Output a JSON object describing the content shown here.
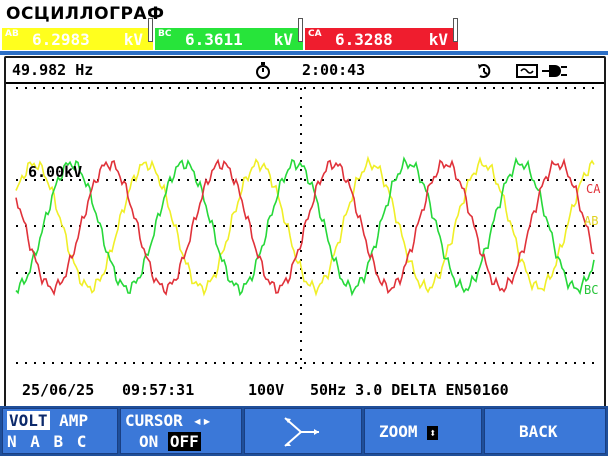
{
  "header": {
    "title": "ОСЦИЛЛОГРАФ"
  },
  "readings": [
    {
      "phase": "AB",
      "value": "6.2983",
      "unit": "kV",
      "color": "#ffff1e"
    },
    {
      "phase": "BC",
      "value": "6.3611",
      "unit": "kV",
      "color": "#27e43a"
    },
    {
      "phase": "CA",
      "value": "6.3288",
      "unit": "kV",
      "color": "#ef1d2e"
    }
  ],
  "status": {
    "frequency": "49.982 Hz",
    "time": "2:00:43",
    "timer_icon": "stopwatch-icon",
    "trend_icon": "trend-icon",
    "power_icon": "mains-plug-icon"
  },
  "scope": {
    "scale_label": "6.00kV",
    "channel_labels": [
      "CA",
      "AB",
      "BC"
    ],
    "grid": true
  },
  "footer": {
    "date": "25/06/25",
    "clock": "09:57:31",
    "nominal": "100V",
    "config": "50Hz 3.0 DELTA EN50160"
  },
  "function_keys": {
    "volt_label": "VOLT",
    "amp_label": "AMP",
    "phases_row": "N A B C",
    "cursor_label": "CURSOR",
    "cursor_on": "ON",
    "cursor_off": "OFF",
    "zoom_label": "ZOOM",
    "back_label": "BACK"
  },
  "chart_data": {
    "type": "line",
    "xlabel": "",
    "ylabel": "",
    "ylim": [
      -9,
      9
    ],
    "series": [
      {
        "name": "AB",
        "amplitude_kV": 6.2983,
        "color": "#f0ef28"
      },
      {
        "name": "BC",
        "amplitude_kV": 6.3611,
        "color": "#27d83a"
      },
      {
        "name": "CA",
        "amplitude_kV": 6.3288,
        "color": "#e0323a"
      }
    ]
  }
}
